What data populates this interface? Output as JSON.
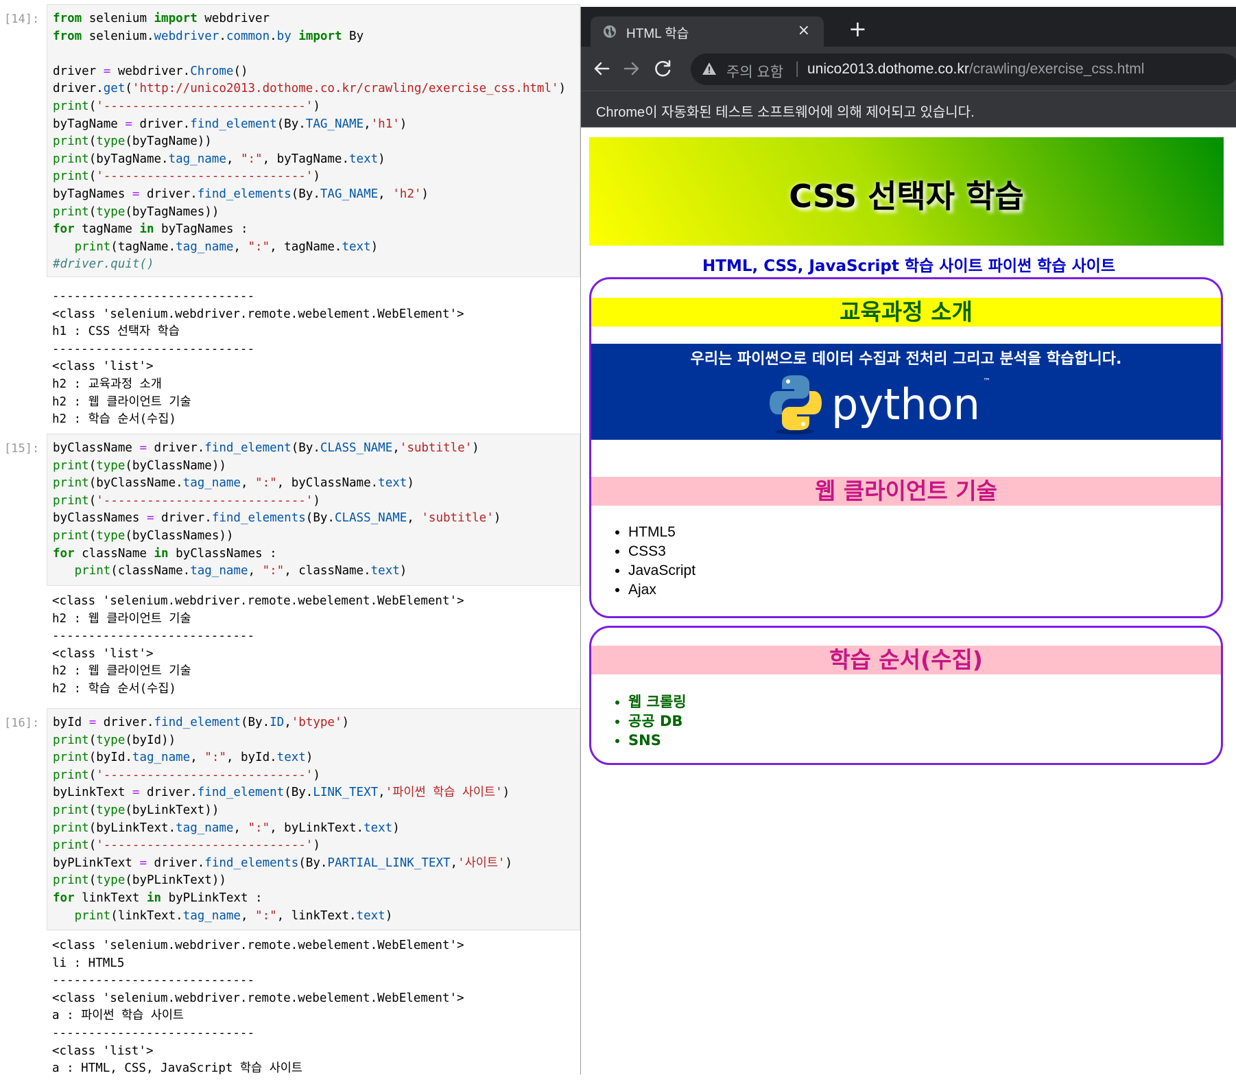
{
  "notebook": {
    "cells": [
      {
        "prompt": "[14]:",
        "code_lines": [
          "from selenium import webdriver",
          "from selenium.webdriver.common.by import By",
          "",
          "driver = webdriver.Chrome()",
          "driver.get('http://unico2013.dothome.co.kr/crawling/exercise_css.html')",
          "print('----------------------------')",
          "byTagName = driver.find_element(By.TAG_NAME,'h1')",
          "print(type(byTagName))",
          "print(byTagName.tag_name, \":\", byTagName.text)",
          "print('----------------------------')",
          "byTagNames = driver.find_elements(By.TAG_NAME, 'h2')",
          "print(type(byTagNames))",
          "for tagName in byTagNames :",
          "   print(tagName.tag_name, \":\", tagName.text)",
          "#driver.quit()"
        ],
        "output_lines": [
          "----------------------------",
          "<class 'selenium.webdriver.remote.webelement.WebElement'>",
          "h1 : CSS 선택자 학습",
          "----------------------------",
          "<class 'list'>",
          "h2 : 교육과정 소개",
          "h2 : 웹 클라이언트 기술",
          "h2 : 학습 순서(수집)"
        ]
      },
      {
        "prompt": "[15]:",
        "code_lines": [
          "byClassName = driver.find_element(By.CLASS_NAME,'subtitle')",
          "print(type(byClassName))",
          "print(byClassName.tag_name, \":\", byClassName.text)",
          "print('----------------------------')",
          "byClassNames = driver.find_elements(By.CLASS_NAME, 'subtitle')",
          "print(type(byClassNames))",
          "for className in byClassNames :",
          "   print(className.tag_name, \":\", className.text)"
        ],
        "output_lines": [
          "<class 'selenium.webdriver.remote.webelement.WebElement'>",
          "h2 : 웹 클라이언트 기술",
          "----------------------------",
          "<class 'list'>",
          "h2 : 웹 클라이언트 기술",
          "h2 : 학습 순서(수집)"
        ]
      },
      {
        "prompt": "[16]:",
        "code_lines": [
          "byId = driver.find_element(By.ID,'btype')",
          "print(type(byId))",
          "print(byId.tag_name, \":\", byId.text)",
          "print('----------------------------')",
          "byLinkText = driver.find_element(By.LINK_TEXT,'파이썬 학습 사이트')",
          "print(type(byLinkText))",
          "print(byLinkText.tag_name, \":\", byLinkText.text)",
          "print('----------------------------')",
          "byPLinkText = driver.find_elements(By.PARTIAL_LINK_TEXT,'사이트')",
          "print(type(byPLinkText))",
          "for linkText in byPLinkText :",
          "   print(linkText.tag_name, \":\", linkText.text)"
        ],
        "output_lines": [
          "<class 'selenium.webdriver.remote.webelement.WebElement'>",
          "li : HTML5",
          "----------------------------",
          "<class 'selenium.webdriver.remote.webelement.WebElement'>",
          "a : 파이썬 학습 사이트",
          "----------------------------",
          "<class 'list'>",
          "a : HTML, CSS, JavaScript 학습 사이트"
        ]
      }
    ]
  },
  "browser": {
    "tab_title": "HTML 학습",
    "tab_close": "×",
    "new_tab": "+",
    "security_label": "주의 요함",
    "separator": "|",
    "url_host": "unico2013.dothome.co.kr",
    "url_path": "/crawling/exercise_css.html",
    "infobar_text": "Chrome이 자동화된 테스트 소프트웨어에 의해 제어되고 있습니다.",
    "icons": [
      "globe-icon",
      "close-icon",
      "plus-icon",
      "back-icon",
      "forward-icon",
      "reload-icon",
      "warning-icon"
    ]
  },
  "page": {
    "h1": "CSS 선택자 학습",
    "links": {
      "link1": "HTML, CSS, JavaScript 학습 사이트",
      "link2": "파이썬 학습 사이트"
    },
    "section1": {
      "h2": "교육과정 소개",
      "tagline": "우리는 파이썬으로 데이터 수집과 전처리 그리고 분석을 학습합니다.",
      "logo_text": "python",
      "logo_tm": "™"
    },
    "section2": {
      "h2": "웹 클라이언트 기술",
      "items": [
        "HTML5",
        "CSS3",
        "JavaScript",
        "Ajax"
      ]
    },
    "section3": {
      "h2": "학습 순서(수집)",
      "items": [
        "웹 크롤링",
        "공공 DB",
        "SNS"
      ]
    },
    "colors": {
      "banner_gradient_start": "#ffff00",
      "banner_gradient_end": "#009000",
      "link_blue": "#0000cd",
      "box_border": "#7b1fe0",
      "h2_edu_bg": "#ffff00",
      "h2_edu_fg": "#006400",
      "h2_pink_bg": "#ffc0cb",
      "h2_pink_fg": "#c71585",
      "python_bg": "#003399"
    }
  }
}
